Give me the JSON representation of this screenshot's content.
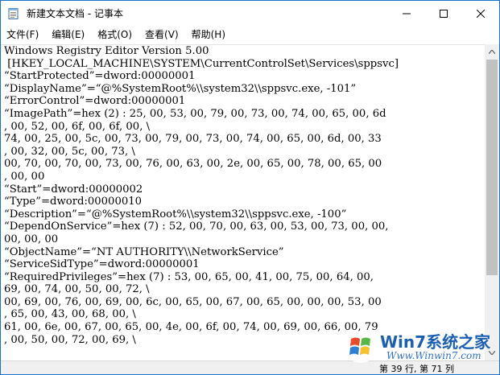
{
  "window": {
    "title": "新建文本文档 - 记事本",
    "controls": [
      "minimize-icon",
      "maximize-icon",
      "close-icon"
    ]
  },
  "menu": [
    "文件(F)",
    "编辑(E)",
    "格式(O)",
    "查看(V)",
    "帮助(H)"
  ],
  "lines": [
    "Windows Registry Editor Version 5.00",
    " [HKEY_LOCAL_MACHINE\\SYSTEM\\CurrentControlSet\\Services\\sppsvc]",
    "“StartProtected”=dword:00000001",
    "“DisplayName”=“@%SystemRoot%\\\\system32\\\\sppsvc.exe, -101”",
    "“ErrorControl”=dword:00000001",
    "“ImagePath”=hex (2) : 25, 00, 53, 00, 79, 00, 73, 00, 74, 00, 65, 00, 6d",
    ", 00, 52, 00, 6f, 00, 6f, 00, \\",
    "74, 00, 25, 00, 5c, 00, 73, 00, 79, 00, 73, 00, 74, 00, 65, 00, 6d, 00, 33",
    ", 00, 32, 00, 5c, 00, 73, \\",
    "00, 70, 00, 70, 00, 73, 00, 76, 00, 63, 00, 2e, 00, 65, 00, 78, 00, 65, 00",
    ", 00, 00",
    "“Start”=dword:00000002",
    "“Type”=dword:00000010",
    "“Description”=“@%SystemRoot%\\\\system32\\\\sppsvc.exe, -100”",
    "“DependOnService”=hex (7) : 52, 00, 70, 00, 63, 00, 53, 00, 73, 00, 00,",
    "00, 00, 00",
    "“ObjectName”=“NT AUTHORITY\\\\NetworkService”",
    "“ServiceSidType”=dword:00000001",
    "“RequiredPrivileges”=hex (7) : 53, 00, 65, 00, 41, 00, 75, 00, 64, 00,",
    "69, 00, 74, 00, 50, 00, 72, \\",
    "00, 69, 00, 76, 00, 69, 00, 6c, 00, 65, 00, 67, 00, 65, 00, 00, 00, 53, 00",
    ", 65, 00, 43, 00, 68, 00, \\",
    "61, 00, 6e, 00, 67, 00, 65, 00, 4e, 00, 6f, 00, 74, 00, 69, 00, 66, 00, 79",
    ", 00, 50, 00, 72, 00, 69, \\"
  ],
  "status": {
    "position": "第 39 行, 第 71 列"
  },
  "watermark": {
    "brand": "Win7系统之家",
    "url": "Www.Winwin7.com"
  },
  "colors": {
    "border": "#1a73c8",
    "scrollbar_track": "#f0f0f0",
    "scrollbar_thumb": "#c1c1c1"
  }
}
